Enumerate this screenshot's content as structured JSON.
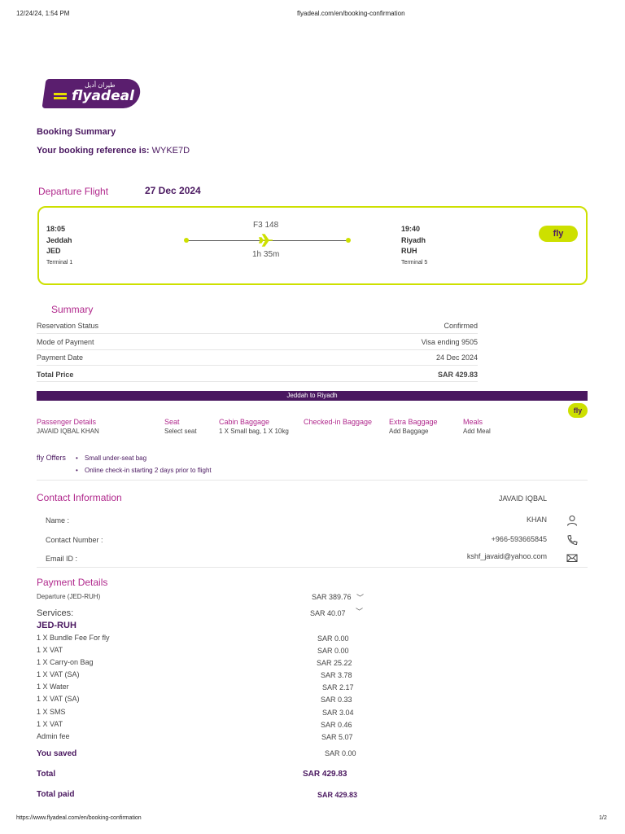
{
  "header": {
    "datetime": "12/24/24, 1:54 PM",
    "url": "flyadeal.com/en/booking-confirmation"
  },
  "logo": {
    "text": "flyadeal",
    "arabic": "طيران أديل"
  },
  "booking": {
    "title": "Booking Summary",
    "ref_label": "Your booking reference is:",
    "ref": "WYKE7D"
  },
  "departure": {
    "title": "Departure Flight",
    "date": "27 Dec 2024"
  },
  "flight": {
    "dep_time": "18:05",
    "dep_city": "Jeddah",
    "dep_code": "JED",
    "dep_terminal": "Terminal 1",
    "number": "F3 148",
    "duration": "1h 35m",
    "arr_time": "19:40",
    "arr_city": "Riyadh",
    "arr_code": "RUH",
    "arr_terminal": "Terminal 5",
    "brand": "fly"
  },
  "summary": {
    "title": "Summary",
    "rows": [
      {
        "label": "Reservation Status",
        "value": "Confirmed"
      },
      {
        "label": "Mode of Payment",
        "value": "Visa ending 9505"
      },
      {
        "label": "Payment Date",
        "value": "24 Dec 2024"
      },
      {
        "label": "Total Price",
        "value": "SAR 429.83"
      }
    ]
  },
  "segment": {
    "band": "Jeddah to Riyadh",
    "brand": "fly"
  },
  "passenger": {
    "headers": [
      "Passenger Details",
      "Seat",
      "Cabin Baggage",
      "Checked-in Baggage",
      "Extra Baggage",
      "Meals"
    ],
    "values": [
      "JAVAID IQBAL KHAN",
      "Select seat",
      "1 X Small bag, 1 X 10kg",
      "",
      "Add Baggage",
      "Add Meal"
    ]
  },
  "offers": {
    "label": "fly  Offers",
    "items": [
      "Small under-seat bag",
      "Online check-in starting 2 days prior to flight"
    ]
  },
  "contact": {
    "title": "Contact Information",
    "first_name": "JAVAID IQBAL",
    "name_label": "Name :",
    "name_value": "KHAN",
    "phone_label": "Contact Number :",
    "phone_value": "+966-593665845",
    "email_label": "Email ID :",
    "email_value": "kshf_javaid@yahoo.com"
  },
  "payment": {
    "title": "Payment Details",
    "departure_label": "Departure  (JED-RUH)",
    "departure_value": "SAR 389.76",
    "services_label": "Services:",
    "services_value": "SAR 40.07",
    "route": "JED-RUH",
    "items": [
      {
        "label": "1 X Bundle Fee For fly",
        "value": "SAR 0.00"
      },
      {
        "label": "1 X VAT",
        "value": "SAR 0.00"
      },
      {
        "label": "1 X Carry-on Bag",
        "value": "SAR 25.22"
      },
      {
        "label": "1 X VAT (SA)",
        "value": "SAR 3.78"
      },
      {
        "label": "1 X Water",
        "value": "SAR 2.17"
      },
      {
        "label": "1 X VAT (SA)",
        "value": "SAR 0.33"
      },
      {
        "label": "1 X SMS",
        "value": "SAR 3.04"
      },
      {
        "label": "1 X VAT",
        "value": "SAR 0.46"
      },
      {
        "label": "Admin fee",
        "value": "SAR 5.07"
      }
    ],
    "saved_label": "You saved",
    "saved_value": "SAR 0.00",
    "total_label": "Total",
    "total_value": "SAR 429.83",
    "paid_label": "Total paid",
    "paid_value": "SAR 429.83"
  },
  "footer": {
    "url": "https://www.flyadeal.com/en/booking-confirmation",
    "page": "1/2"
  },
  "colors": {
    "purple": "#4a1860",
    "magenta": "#b0288c",
    "lime": "#cde000"
  }
}
